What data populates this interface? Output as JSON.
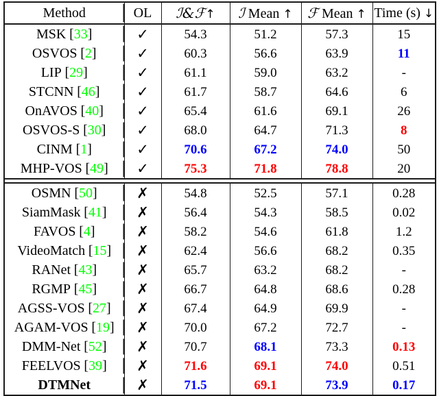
{
  "table": {
    "columns": [
      {
        "key": "method",
        "label": "Method"
      },
      {
        "key": "ol",
        "label": "OL"
      },
      {
        "key": "jf",
        "label_math": "ℐ&ℱ",
        "label_arrow": "↑"
      },
      {
        "key": "jmean",
        "label_math": "ℐ",
        "label_text": " Mean ",
        "label_arrow": "↑"
      },
      {
        "key": "fmean",
        "label_math": "ℱ",
        "label_text": " Mean ",
        "label_arrow": "↑"
      },
      {
        "key": "time",
        "label_text": "Time (s) ",
        "label_arrow": "↓"
      }
    ],
    "marks": {
      "yes": "✓",
      "no": "✗"
    },
    "colors": {
      "citation": "#00ff00",
      "best": "#ff0000",
      "second": "#0000ff",
      "text": "#000000"
    },
    "sections": [
      {
        "name": "online-learning",
        "rows": [
          {
            "method": "MSK",
            "cite": "[33]",
            "ol": "yes",
            "jf": {
              "v": "54.3",
              "c": "black"
            },
            "jmean": {
              "v": "51.2",
              "c": "black"
            },
            "fmean": {
              "v": "57.3",
              "c": "black"
            },
            "time": {
              "v": "15",
              "c": "black"
            }
          },
          {
            "method": "OSVOS",
            "cite": "[2]",
            "ol": "yes",
            "jf": {
              "v": "60.3",
              "c": "black"
            },
            "jmean": {
              "v": "56.6",
              "c": "black"
            },
            "fmean": {
              "v": "63.9",
              "c": "black"
            },
            "time": {
              "v": "11",
              "c": "blue"
            }
          },
          {
            "method": "LIP",
            "cite": "[29]",
            "ol": "yes",
            "jf": {
              "v": "61.1",
              "c": "black"
            },
            "jmean": {
              "v": "59.0",
              "c": "black"
            },
            "fmean": {
              "v": "63.2",
              "c": "black"
            },
            "time": {
              "v": "-",
              "c": "black"
            }
          },
          {
            "method": "STCNN",
            "cite": "[46]",
            "ol": "yes",
            "jf": {
              "v": "61.7",
              "c": "black"
            },
            "jmean": {
              "v": "58.7",
              "c": "black"
            },
            "fmean": {
              "v": "64.6",
              "c": "black"
            },
            "time": {
              "v": "6",
              "c": "black"
            }
          },
          {
            "method": "OnAVOS",
            "cite": "[40]",
            "ol": "yes",
            "jf": {
              "v": "65.4",
              "c": "black"
            },
            "jmean": {
              "v": "61.6",
              "c": "black"
            },
            "fmean": {
              "v": "69.1",
              "c": "black"
            },
            "time": {
              "v": "26",
              "c": "black"
            }
          },
          {
            "method": "OSVOS-S",
            "cite": "[30]",
            "ol": "yes",
            "jf": {
              "v": "68.0",
              "c": "black"
            },
            "jmean": {
              "v": "64.7",
              "c": "black"
            },
            "fmean": {
              "v": "71.3",
              "c": "black"
            },
            "time": {
              "v": "8",
              "c": "red"
            }
          },
          {
            "method": "CINM",
            "cite": "[1]",
            "ol": "yes",
            "jf": {
              "v": "70.6",
              "c": "blue"
            },
            "jmean": {
              "v": "67.2",
              "c": "blue"
            },
            "fmean": {
              "v": "74.0",
              "c": "blue"
            },
            "time": {
              "v": "50",
              "c": "black"
            }
          },
          {
            "method": "MHP-VOS",
            "cite": "[49]",
            "ol": "yes",
            "jf": {
              "v": "75.3",
              "c": "red"
            },
            "jmean": {
              "v": "71.8",
              "c": "red"
            },
            "fmean": {
              "v": "78.8",
              "c": "red"
            },
            "time": {
              "v": "20",
              "c": "black"
            }
          }
        ]
      },
      {
        "name": "no-online-learning",
        "rows": [
          {
            "method": "OSMN",
            "cite": "[50]",
            "ol": "no",
            "jf": {
              "v": "54.8",
              "c": "black"
            },
            "jmean": {
              "v": "52.5",
              "c": "black"
            },
            "fmean": {
              "v": "57.1",
              "c": "black"
            },
            "time": {
              "v": "0.28",
              "c": "black"
            }
          },
          {
            "method": "SiamMask",
            "cite": "[41]",
            "ol": "no",
            "jf": {
              "v": "56.4",
              "c": "black"
            },
            "jmean": {
              "v": "54.3",
              "c": "black"
            },
            "fmean": {
              "v": "58.5",
              "c": "black"
            },
            "time": {
              "v": "0.02",
              "c": "black"
            }
          },
          {
            "method": "FAVOS",
            "cite": "[4]",
            "ol": "no",
            "jf": {
              "v": "58.2",
              "c": "black"
            },
            "jmean": {
              "v": "54.6",
              "c": "black"
            },
            "fmean": {
              "v": "61.8",
              "c": "black"
            },
            "time": {
              "v": "1.2",
              "c": "black"
            }
          },
          {
            "method": "VideoMatch",
            "cite": "[15]",
            "ol": "no",
            "jf": {
              "v": "62.4",
              "c": "black"
            },
            "jmean": {
              "v": "56.6",
              "c": "black"
            },
            "fmean": {
              "v": "68.2",
              "c": "black"
            },
            "time": {
              "v": "0.35",
              "c": "black"
            }
          },
          {
            "method": "RANet",
            "cite": "[43]",
            "ol": "no",
            "jf": {
              "v": "65.7",
              "c": "black"
            },
            "jmean": {
              "v": "63.2",
              "c": "black"
            },
            "fmean": {
              "v": "68.2",
              "c": "black"
            },
            "time": {
              "v": "-",
              "c": "black"
            }
          },
          {
            "method": "RGMP",
            "cite": "[45]",
            "ol": "no",
            "jf": {
              "v": "66.7",
              "c": "black"
            },
            "jmean": {
              "v": "64.8",
              "c": "black"
            },
            "fmean": {
              "v": "68.6",
              "c": "black"
            },
            "time": {
              "v": "0.28",
              "c": "black"
            }
          },
          {
            "method": "AGSS-VOS",
            "cite": "[27]",
            "ol": "no",
            "jf": {
              "v": "67.4",
              "c": "black"
            },
            "jmean": {
              "v": "64.9",
              "c": "black"
            },
            "fmean": {
              "v": "69.9",
              "c": "black"
            },
            "time": {
              "v": "-",
              "c": "black"
            }
          },
          {
            "method": "AGAM-VOS",
            "cite": "[19]",
            "ol": "no",
            "jf": {
              "v": "70.0",
              "c": "black"
            },
            "jmean": {
              "v": "67.2",
              "c": "black"
            },
            "fmean": {
              "v": "72.7",
              "c": "black"
            },
            "time": {
              "v": "-",
              "c": "black"
            }
          },
          {
            "method": "DMM-Net",
            "cite": "[52]",
            "ol": "no",
            "jf": {
              "v": "70.7",
              "c": "black"
            },
            "jmean": {
              "v": "68.1",
              "c": "blue"
            },
            "fmean": {
              "v": "73.3",
              "c": "black"
            },
            "time": {
              "v": "0.13",
              "c": "red"
            }
          },
          {
            "method": "FEELVOS",
            "cite": "[39]",
            "ol": "no",
            "jf": {
              "v": "71.6",
              "c": "red"
            },
            "jmean": {
              "v": "69.1",
              "c": "red"
            },
            "fmean": {
              "v": "74.0",
              "c": "red"
            },
            "time": {
              "v": "0.51",
              "c": "black"
            }
          },
          {
            "method": "DTMNet",
            "cite": "",
            "ol": "no",
            "bold_method": true,
            "jf": {
              "v": "71.5",
              "c": "blue"
            },
            "jmean": {
              "v": "69.1",
              "c": "red"
            },
            "fmean": {
              "v": "73.9",
              "c": "blue"
            },
            "time": {
              "v": "0.17",
              "c": "blue"
            }
          }
        ]
      }
    ]
  }
}
